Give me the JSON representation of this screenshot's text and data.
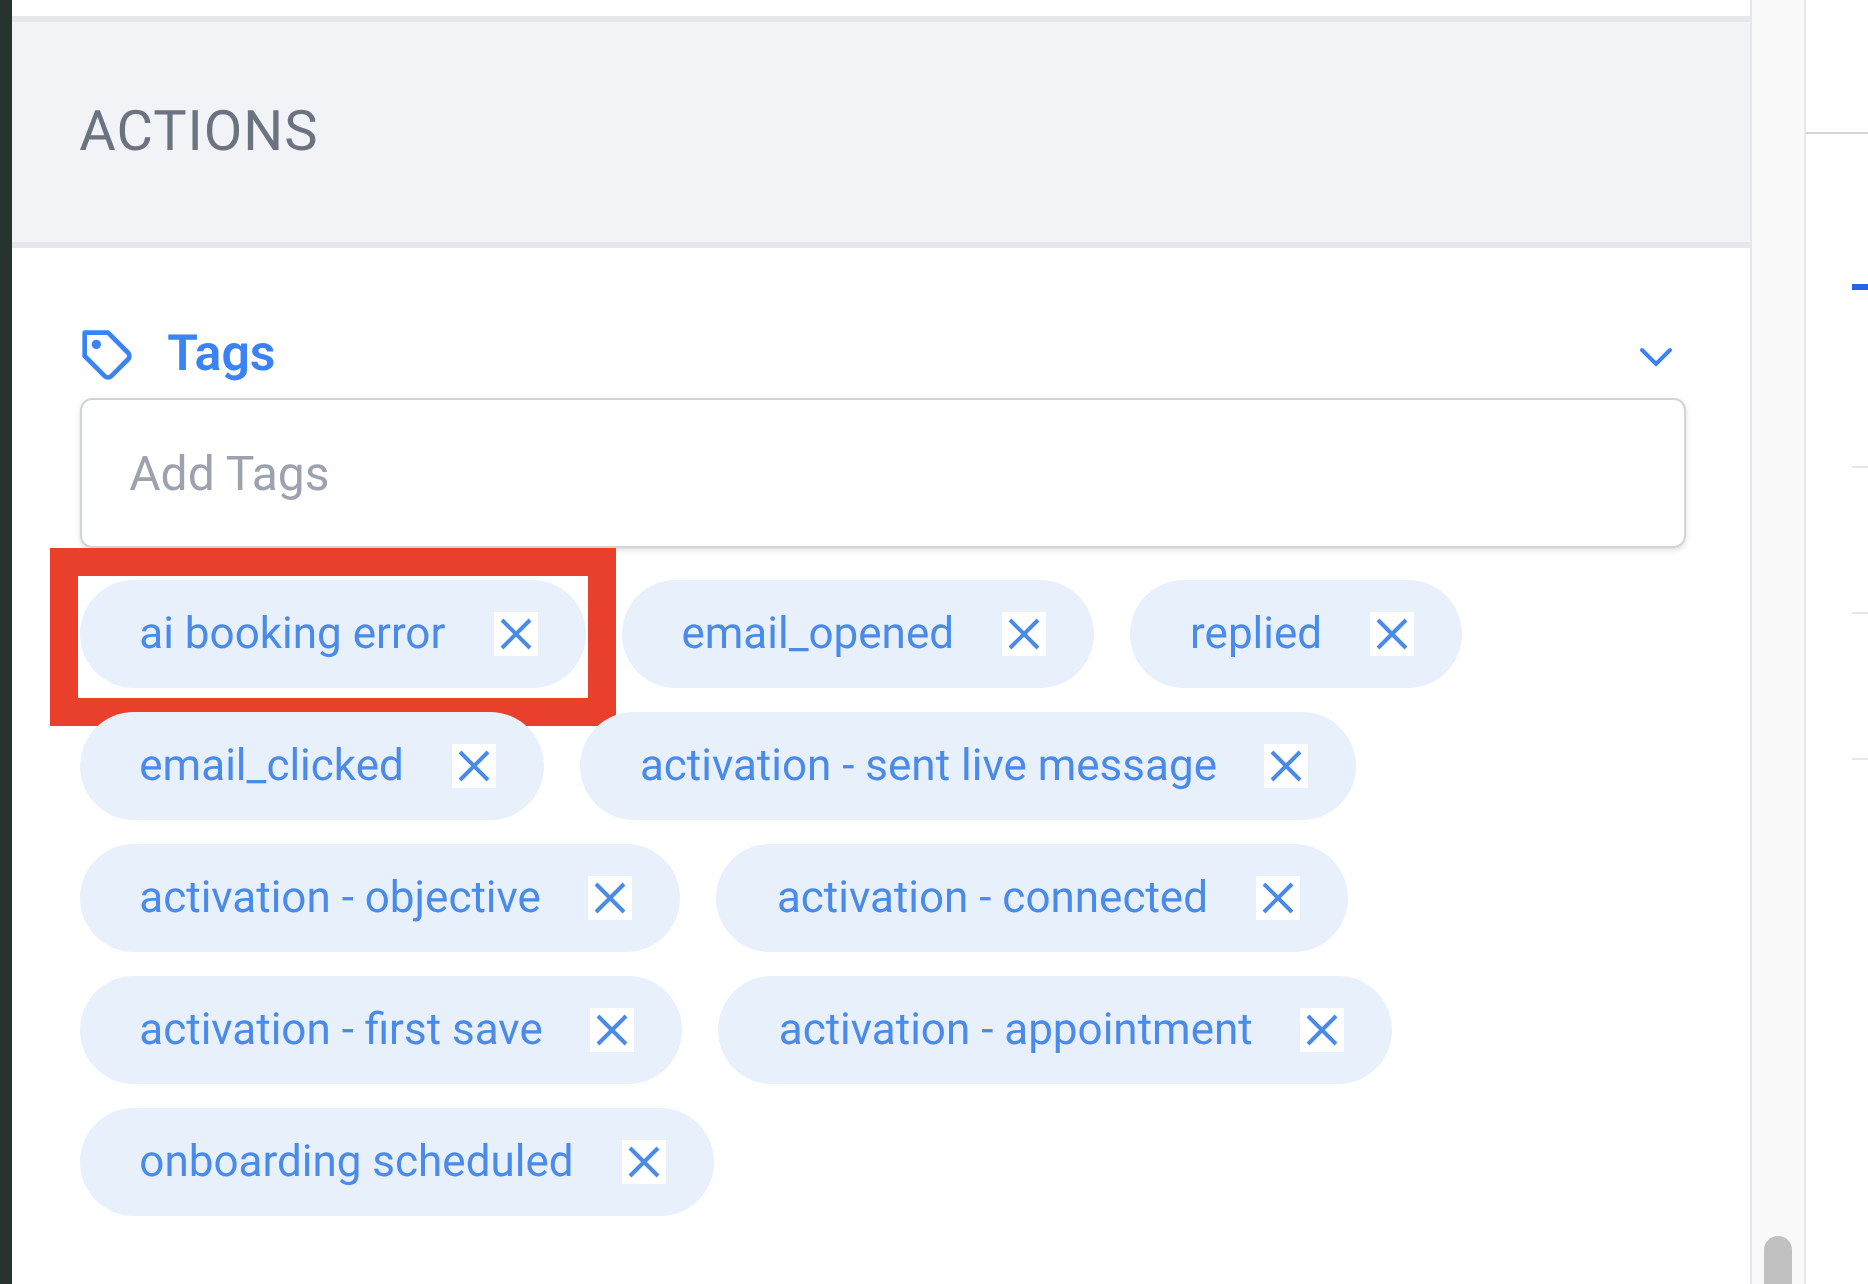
{
  "section": {
    "title": "ACTIONS"
  },
  "tags_panel": {
    "title": "Tags",
    "expanded": true,
    "input": {
      "placeholder": "Add Tags"
    },
    "tags": [
      {
        "label": "ai booking error",
        "highlighted": true
      },
      {
        "label": "email_opened",
        "highlighted": false
      },
      {
        "label": "replied",
        "highlighted": false
      },
      {
        "label": "email_clicked",
        "highlighted": false
      },
      {
        "label": "activation - sent live message",
        "highlighted": false
      },
      {
        "label": "activation - objective",
        "highlighted": false
      },
      {
        "label": "activation - connected",
        "highlighted": false
      },
      {
        "label": "activation - first save",
        "highlighted": false
      },
      {
        "label": "activation - appointment",
        "highlighted": false
      },
      {
        "label": "onboarding scheduled",
        "highlighted": false
      }
    ]
  },
  "side_panel": {
    "tabs": [
      {
        "selected": true
      }
    ]
  }
}
